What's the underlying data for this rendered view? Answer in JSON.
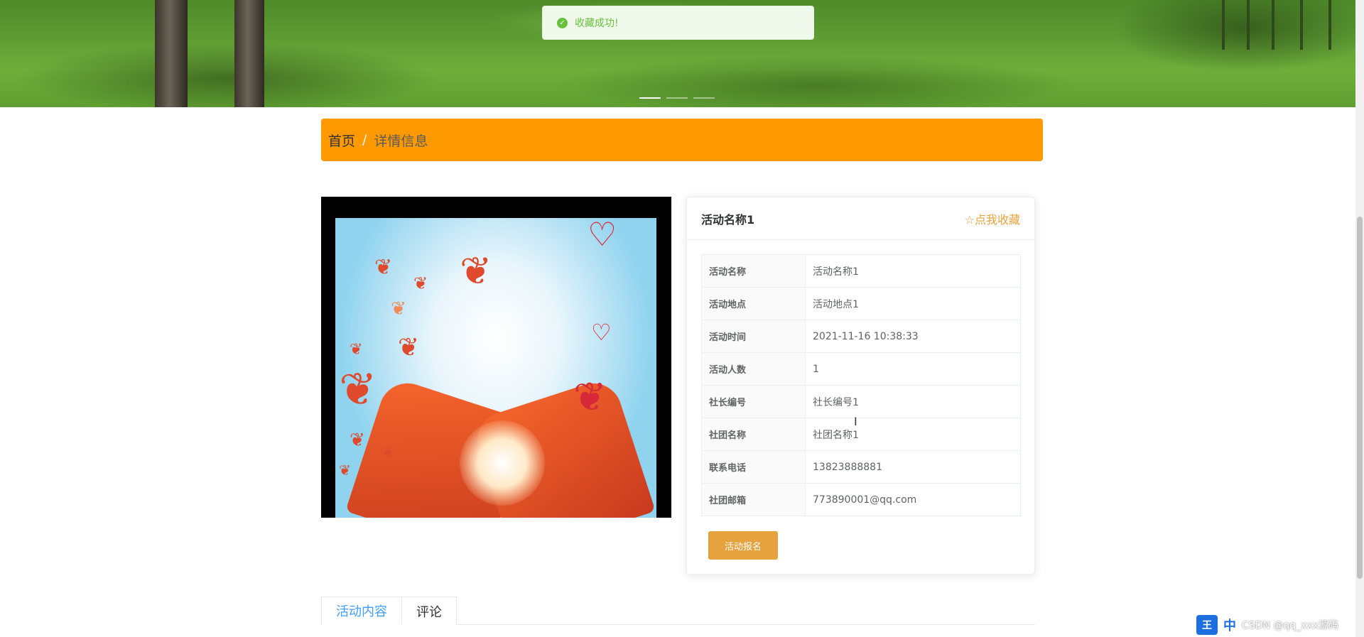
{
  "toast": {
    "message": "收藏成功!"
  },
  "breadcrumb": {
    "home": "首页",
    "separator": "/",
    "current": "详情信息"
  },
  "detail": {
    "title": "活动名称1",
    "favorite_label": "☆点我收藏",
    "rows": [
      {
        "label": "活动名称",
        "value": "活动名称1"
      },
      {
        "label": "活动地点",
        "value": "活动地点1"
      },
      {
        "label": "活动时间",
        "value": "2021-11-16 10:38:33"
      },
      {
        "label": "活动人数",
        "value": "1"
      },
      {
        "label": "社长编号",
        "value": "社长编号1"
      },
      {
        "label": "社团名称",
        "value": "社团名称1"
      },
      {
        "label": "联系电话",
        "value": "13823888881"
      },
      {
        "label": "社团邮箱",
        "value": "773890001@qq.com"
      }
    ],
    "signup_label": "活动报名"
  },
  "tabs": [
    {
      "label": "活动内容",
      "active": true
    },
    {
      "label": "评论",
      "active": false
    }
  ],
  "ime": {
    "logo": "王",
    "mode": "中",
    "watermark": "CSDN @qq_xxx源码"
  },
  "colors": {
    "breadcrumb_bg": "#ff9900",
    "accent": "#e6a23c",
    "success": "#67c23a",
    "tab_active": "#409eff"
  }
}
